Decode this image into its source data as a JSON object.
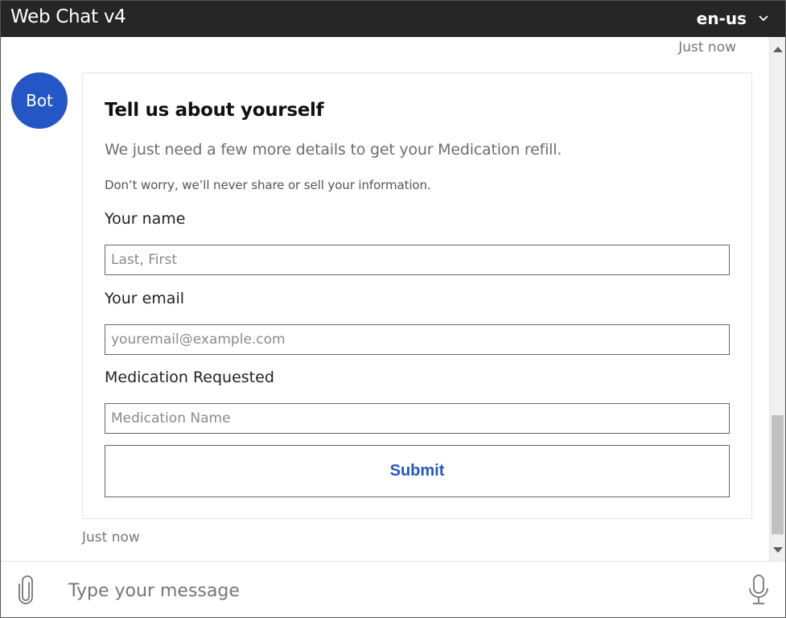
{
  "window": {
    "title": "Web Chat v4"
  },
  "language": {
    "selected": "en-us",
    "icon": "chevron-down-icon"
  },
  "transcript": {
    "top_timestamp": "Just now",
    "bot_avatar_text": "Bot",
    "card": {
      "heading": "Tell us about yourself",
      "subtitle": "We just need a few more details to get your Medication refill.",
      "note": "Don’t worry, we’ll never share or sell your information.",
      "fields": [
        {
          "label": "Your name",
          "placeholder": "Last, First",
          "value": ""
        },
        {
          "label": "Your email",
          "placeholder": "youremail@example.com",
          "value": ""
        },
        {
          "label": "Medication Requested",
          "placeholder": "Medication Name",
          "value": ""
        }
      ],
      "submit_label": "Submit"
    },
    "bottom_timestamp": "Just now"
  },
  "sendbox": {
    "placeholder": "Type your message",
    "value": "",
    "attach_icon": "paperclip-icon",
    "mic_icon": "microphone-icon"
  },
  "colors": {
    "titlebar_bg": "#262626",
    "accent": "#2457c5"
  }
}
